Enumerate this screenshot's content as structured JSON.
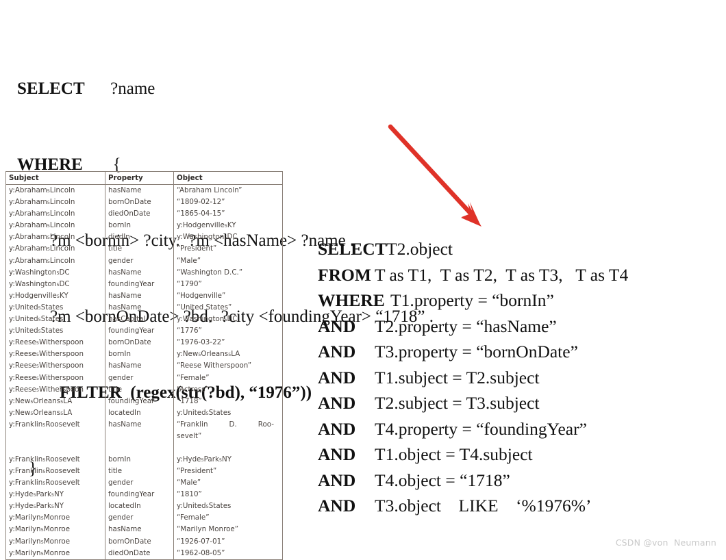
{
  "sparql": {
    "lines": [
      {
        "keyword": "SELECT",
        "indent": 1,
        "rest": "      ?name"
      },
      {
        "keyword": "WHERE",
        "indent": 1,
        "rest": "       {"
      },
      {
        "keyword": "",
        "indent": 2,
        "rest": "?m <bornin> ?city.  ?m <hasName> ?name ."
      },
      {
        "keyword": "",
        "indent": 2,
        "rest": "?m <bornOnDate> ?bd.  ?city <foundingYear> “1718” ."
      },
      {
        "keyword": "FILTER",
        "indent": 3,
        "rest": "  (regex(str(?bd), “1976”))",
        "bold_rest": true
      },
      {
        "keyword": "",
        "indent": 1,
        "rest": "}"
      }
    ]
  },
  "arrow": {
    "color": "#df3228",
    "label": "red-arrow-sparql-to-sql",
    "from": "570,185",
    "to": "700,330"
  },
  "table": {
    "headers": [
      "Subject",
      "Property",
      "Object"
    ],
    "rows": [
      [
        "y:Abraham₅Lincoln",
        "hasName",
        "“Abraham Lincoln”"
      ],
      [
        "y:Abraham₅Lincoln",
        "bornOnDate",
        "“1809-02-12”"
      ],
      [
        "y:Abraham₅Lincoln",
        "diedOnDate",
        "“1865-04-15”"
      ],
      [
        "y:Abraham₅Lincoln",
        "bornIn",
        "y:Hodgenville₅KY"
      ],
      [
        "y:Abraham₅Lincoln",
        "diedIn",
        "y:Washington₅DC"
      ],
      [
        "y:Abraham₅Lincoln",
        "title",
        "“President”"
      ],
      [
        "y:Abraham₅Lincoln",
        "gender",
        "“Male”"
      ],
      [
        "y:Washington₅DC",
        "hasName",
        "“Washington D.C.”"
      ],
      [
        "y:Washington₅DC",
        "foundingYear",
        "“1790”"
      ],
      [
        "y:Hodgenville₅KY",
        "hasName",
        "“Hodgenville”"
      ],
      [
        "y:United₅States",
        "hasName",
        "“United States”"
      ],
      [
        "y:United₅States",
        "hasCapital",
        "y:Washington₅DC"
      ],
      [
        "y:United₅States",
        "foundingYear",
        "“1776”"
      ],
      [
        "y:Reese₅Witherspoon",
        "bornOnDate",
        "“1976-03-22”"
      ],
      [
        "y:Reese₅Witherspoon",
        "bornIn",
        "y:New₅Orleans₅LA"
      ],
      [
        "y:Reese₅Witherspoon",
        "hasName",
        "“Reese Witherspoon”"
      ],
      [
        "y:Reese₅Witherspoon",
        "gender",
        "“Female”"
      ],
      [
        "y:Reese₅Witherspoon",
        "title",
        "“Actress”"
      ],
      [
        "y:New₅Orleans₅LA",
        "foundingYear",
        "“1718”"
      ],
      [
        "y:New₅Orleans₅LA",
        "locatedIn",
        "y:United₅States"
      ],
      [
        "y:Franklin₅Roosevelt",
        "hasName",
        "“Franklin D. Roo-sevelt”"
      ],
      [
        "y:Franklin₅Roosevelt",
        "bornIn",
        "y:Hyde₅Park₅NY"
      ],
      [
        "y:Franklin₅Roosevelt",
        "title",
        "“President”"
      ],
      [
        "y:Franklin₅Roosevelt",
        "gender",
        "“Male”"
      ],
      [
        "y:Hyde₅Park₅NY",
        "foundingYear",
        "“1810”"
      ],
      [
        "y:Hyde₅Park₅NY",
        "locatedIn",
        "y:United₅States"
      ],
      [
        "y:Marilyn₅Monroe",
        "gender",
        "“Female”"
      ],
      [
        "y:Marilyn₅Monroe",
        "hasName",
        "“Marilyn Monroe”"
      ],
      [
        "y:Marilyn₅Monroe",
        "bornOnDate",
        "“1926-07-01”"
      ],
      [
        "y:Marilyn₅Monroe",
        "diedOnDate",
        "“1962-08-05”"
      ]
    ],
    "wrapped_row_index": 20,
    "wrapped_cell": {
      "line1": "“Franklin D. Roo-",
      "line2": "sevelt”"
    }
  },
  "sql": {
    "rows": [
      {
        "keyword": "SELECT",
        "value": "T2.object"
      },
      {
        "keyword": "FROM",
        "value": "T as T1,  T as T2,  T as T3,   T as T4"
      },
      {
        "keyword": "WHERE",
        "value": "T1.property = “bornIn”"
      },
      {
        "keyword": "AND",
        "value": "T2.property = “hasName”"
      },
      {
        "keyword": "AND",
        "value": "T3.property = “bornOnDate”"
      },
      {
        "keyword": "AND",
        "value": "T1.subject = T2.subject"
      },
      {
        "keyword": "AND",
        "value": "T2.subject = T3.subject"
      },
      {
        "keyword": "AND",
        "value": "T4.property = “foundingYear”"
      },
      {
        "keyword": "AND",
        "value": "T1.object = T4.subject"
      },
      {
        "keyword": "AND",
        "value": "T4.object = “1718”"
      },
      {
        "keyword": "AND",
        "value": "T3.object    LIKE    ‘%1976%’"
      }
    ]
  },
  "watermark": {
    "text": "CSDN @von  Neumann"
  }
}
